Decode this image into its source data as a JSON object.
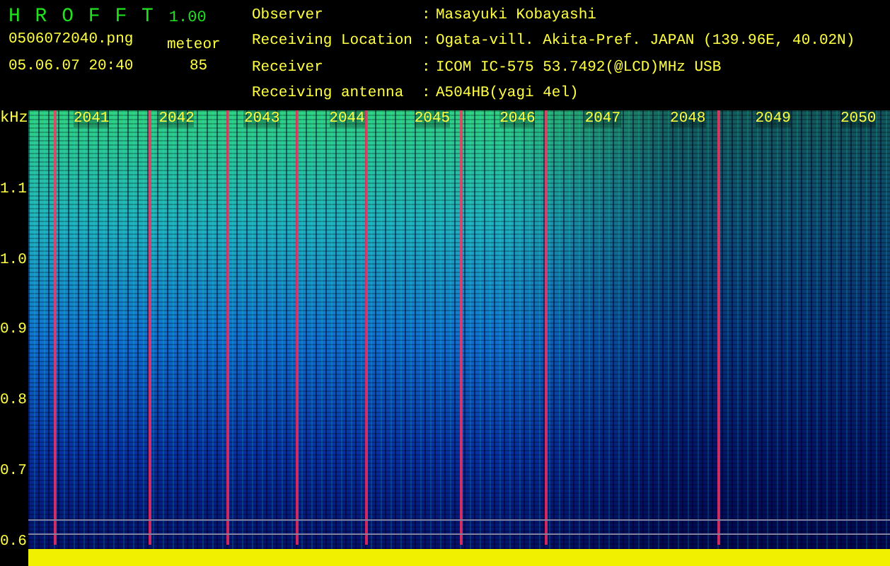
{
  "header": {
    "app_name": "H R O F F T",
    "version": "1.00",
    "filename": "0506072040.png",
    "datetime": "05.06.07 20:40",
    "meteor_label": "meteor",
    "meteor_count": "85"
  },
  "info": [
    {
      "label": "Observer",
      "separator": ":",
      "value": "Masayuki Kobayashi"
    },
    {
      "label": "Receiving Location",
      "separator": ":",
      "value": "Ogata-vill. Akita-Pref. JAPAN (139.96E, 40.02N)"
    },
    {
      "label": "Receiver",
      "separator": ":",
      "value": "ICOM IC-575 53.7492(@LCD)MHz USB"
    },
    {
      "label": "Receiving antenna",
      "separator": ":",
      "value": "A504HB(yagi 4el)"
    }
  ],
  "spectrogram": {
    "y_unit": "kHz",
    "y_labels": [
      "1.1",
      "1.0",
      "0.9",
      "0.8",
      "0.7",
      "0.6"
    ],
    "time_labels": [
      "2041",
      "2042",
      "2043",
      "2044",
      "2045",
      "2046",
      "2047",
      "2048",
      "2049",
      "2050"
    ]
  }
}
